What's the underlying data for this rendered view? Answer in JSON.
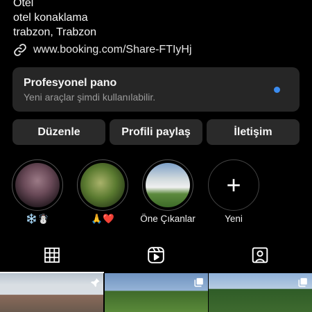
{
  "bio": {
    "category": "Otel",
    "line2": "otel konaklama",
    "location": "trabzon, Trabzon"
  },
  "link": {
    "icon": "link-icon",
    "url": "www.booking.com/Share-FTIyHj"
  },
  "dashboard": {
    "title": "Profesyonel pano",
    "subtitle": "Yeni araçlar şimdi kullanılabilir.",
    "dot_color": "#3b8cf0"
  },
  "actions": {
    "edit": "Düzenle",
    "share": "Profili paylaş",
    "contact": "İletişim"
  },
  "highlights": [
    {
      "caption": "❄️☃️"
    },
    {
      "caption": "🙏❤️"
    },
    {
      "caption": "Öne Çıkanlar"
    },
    {
      "caption": "Yeni",
      "icon": "plus-icon"
    }
  ],
  "tabs": [
    {
      "icon": "grid-icon",
      "active": true
    },
    {
      "icon": "reels-icon",
      "active": false
    },
    {
      "icon": "tagged-icon",
      "active": false
    }
  ],
  "posts": [
    {
      "icon": "pin-icon"
    },
    {
      "icon": "carousel-icon"
    },
    {
      "icon": "carousel-icon"
    }
  ]
}
